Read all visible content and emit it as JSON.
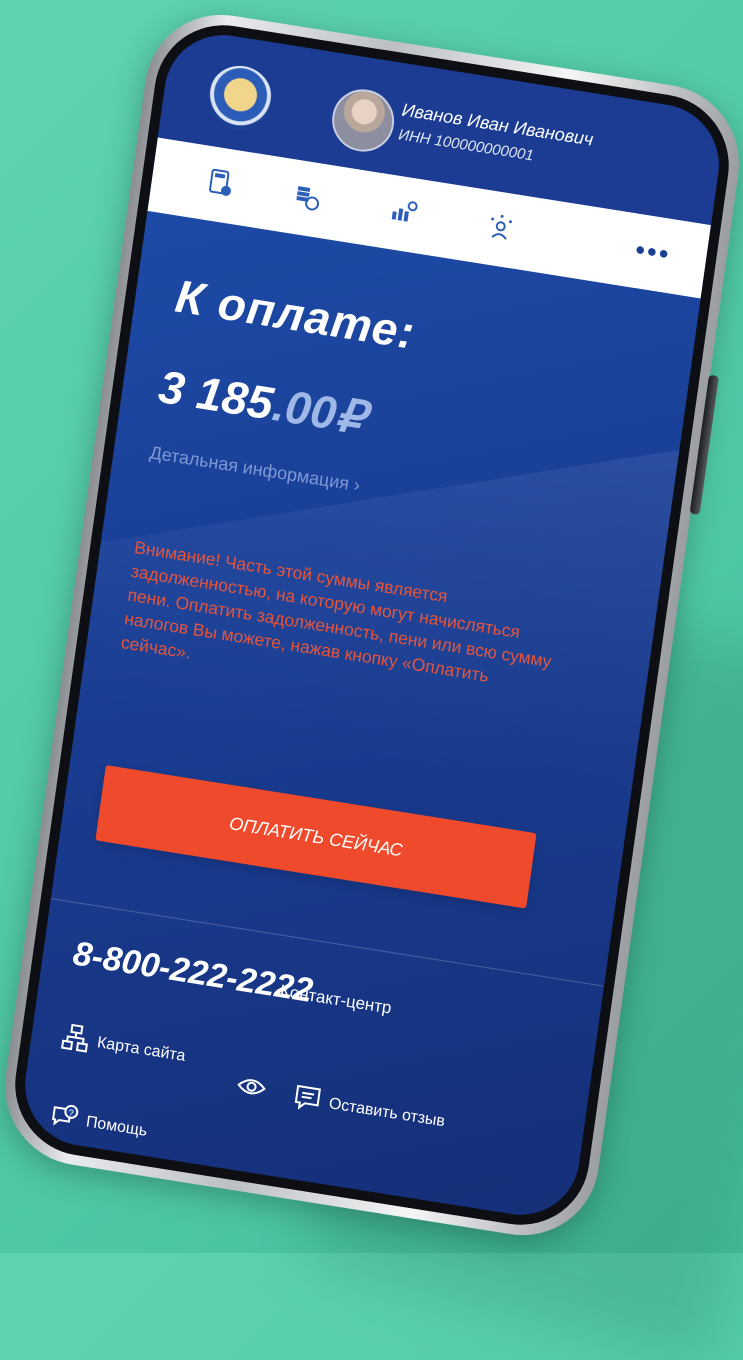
{
  "header": {
    "user_name": "Иванов Иван Иванович",
    "inn": "ИНН 100000000001"
  },
  "toolbar": {
    "icons": [
      "calculator-icon",
      "coins-icon",
      "chart-icon",
      "people-icon"
    ],
    "more_label": "•••"
  },
  "payment": {
    "title": "К оплате:",
    "amount_main": "3 185",
    "amount_cents": ".00₽",
    "detail_link": "Детальная информация ›",
    "warning": "Внимание! Часть этой суммы является задолженностью, на которую могут начисляться пени. Оплатить задолженность, пени или всю сумму налогов Вы можете, нажав кнопку «Оплатить сейчас».",
    "pay_button": "ОПЛАТИТЬ СЕЙЧАС"
  },
  "footer": {
    "phone": "8-800-222-2222",
    "contact_label": "Контакт-центр",
    "sitemap_label": "Карта сайта",
    "feedback_label": "Оставить отзыв",
    "help_label": "Помощь"
  },
  "colors": {
    "accent": "#ef4a2c",
    "brand_blue": "#1b3c92",
    "warning_text": "#e5553b",
    "background": "#4fc9a6"
  }
}
